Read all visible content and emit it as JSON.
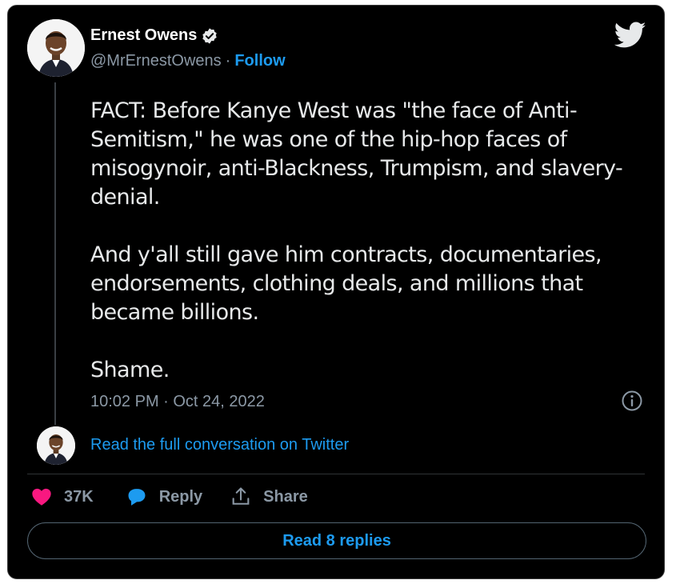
{
  "author": {
    "name": "Ernest Owens",
    "handle": "@MrErnestOwens",
    "separator": "·",
    "follow_label": "Follow"
  },
  "tweet": {
    "text": "FACT: Before Kanye West was \"the face of Anti-\nSemitism,\" he was one of the hip-hop faces of\nmisogynoir, anti-Blackness, Trumpism, and slavery-\ndenial.\n\nAnd y'all still gave him contracts, documentaries,\nendorsements, clothing deals, and millions that\nbecame billions.\n\nShame.",
    "timestamp": "10:02 PM · Oct 24, 2022"
  },
  "conversation": {
    "link_label": "Read the full conversation on Twitter"
  },
  "actions": {
    "like_count": "37K",
    "reply_label": "Reply",
    "share_label": "Share"
  },
  "replies_button": {
    "label": "Read 8 replies"
  },
  "icons": {
    "verified": "verified-badge-icon",
    "logo": "twitter-bird-icon",
    "info": "info-icon",
    "like": "heart-icon",
    "reply": "speech-bubble-icon",
    "share": "share-upload-icon"
  },
  "colors": {
    "background": "#000000",
    "text": "#e7e9ea",
    "muted": "#8b98a5",
    "accent": "#1d9bf0",
    "like": "#f91880"
  }
}
